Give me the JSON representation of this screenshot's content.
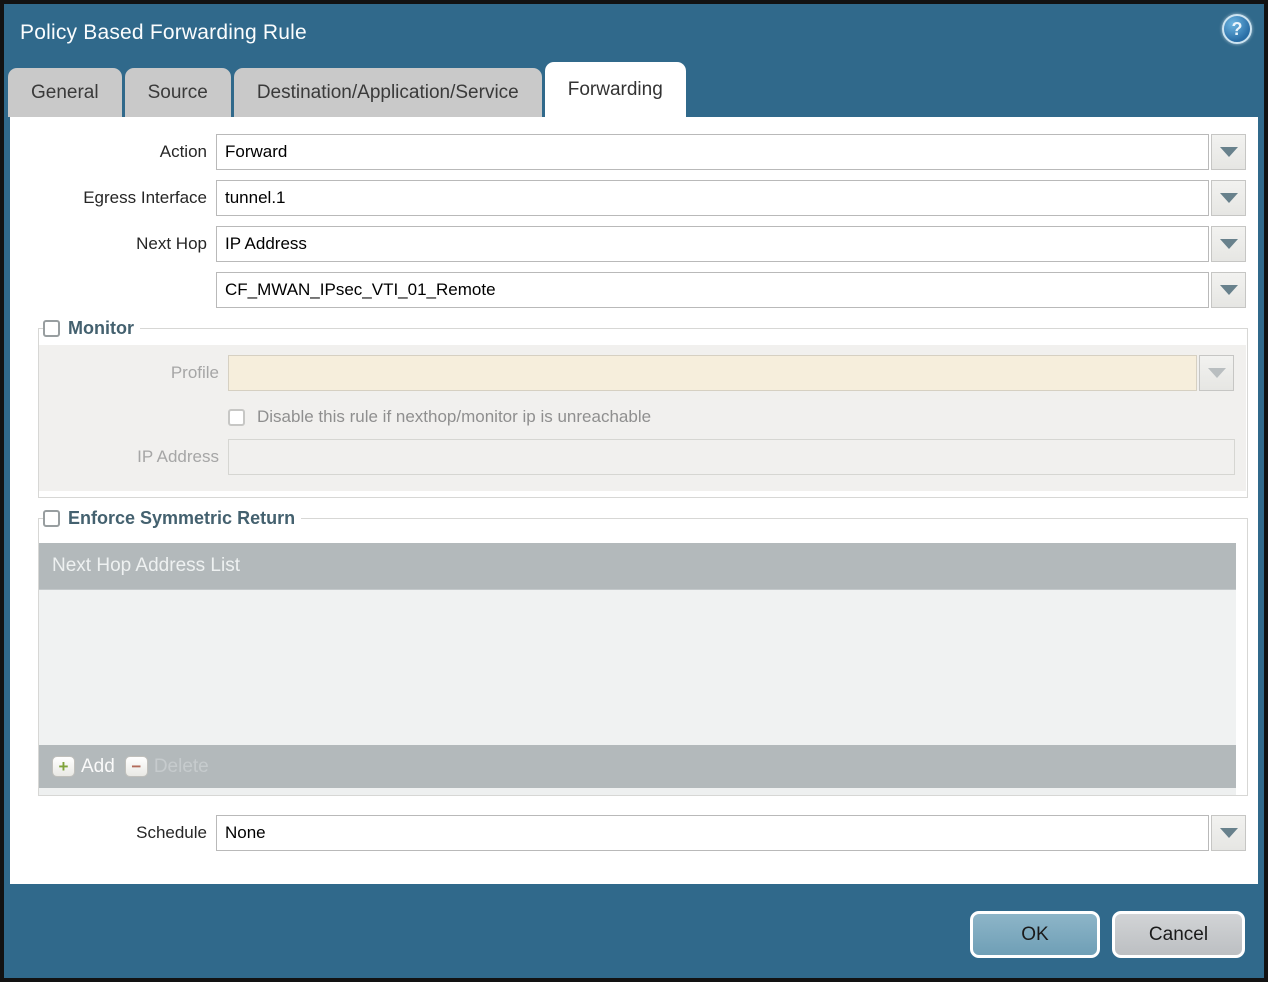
{
  "window": {
    "title": "Policy Based Forwarding Rule",
    "help_icon_glyph": "?"
  },
  "tabs": [
    {
      "label": "General",
      "active": false
    },
    {
      "label": "Source",
      "active": false
    },
    {
      "label": "Destination/Application/Service",
      "active": false
    },
    {
      "label": "Forwarding",
      "active": true
    }
  ],
  "form": {
    "action": {
      "label": "Action",
      "value": "Forward"
    },
    "egress_interface": {
      "label": "Egress Interface",
      "value": "tunnel.1"
    },
    "next_hop": {
      "label": "Next Hop",
      "value": "IP Address"
    },
    "next_hop_address": {
      "value": "CF_MWAN_IPsec_VTI_01_Remote"
    },
    "schedule": {
      "label": "Schedule",
      "value": "None"
    }
  },
  "monitor": {
    "title": "Monitor",
    "checked": false,
    "profile": {
      "label": "Profile",
      "value": ""
    },
    "disable_rule_label": "Disable this rule if nexthop/monitor ip is unreachable",
    "disable_rule_checked": false,
    "ip_address": {
      "label": "IP Address",
      "value": ""
    }
  },
  "symmetric_return": {
    "title": "Enforce Symmetric Return",
    "checked": false,
    "table_header": "Next Hop Address List",
    "rows": [],
    "add_label": "Add",
    "delete_label": "Delete",
    "delete_enabled": false
  },
  "footer": {
    "ok_label": "OK",
    "cancel_label": "Cancel"
  },
  "colors": {
    "chrome_teal": "#30698b",
    "tab_inactive": "#c9c9c9",
    "section_title": "#44616f",
    "table_gray": "#b3b9bb",
    "beige_field": "#f6eedc",
    "ok_button": "#7aa8be",
    "add_plus_green": "#7fa33b",
    "delete_minus_red": "#b26b5b"
  }
}
